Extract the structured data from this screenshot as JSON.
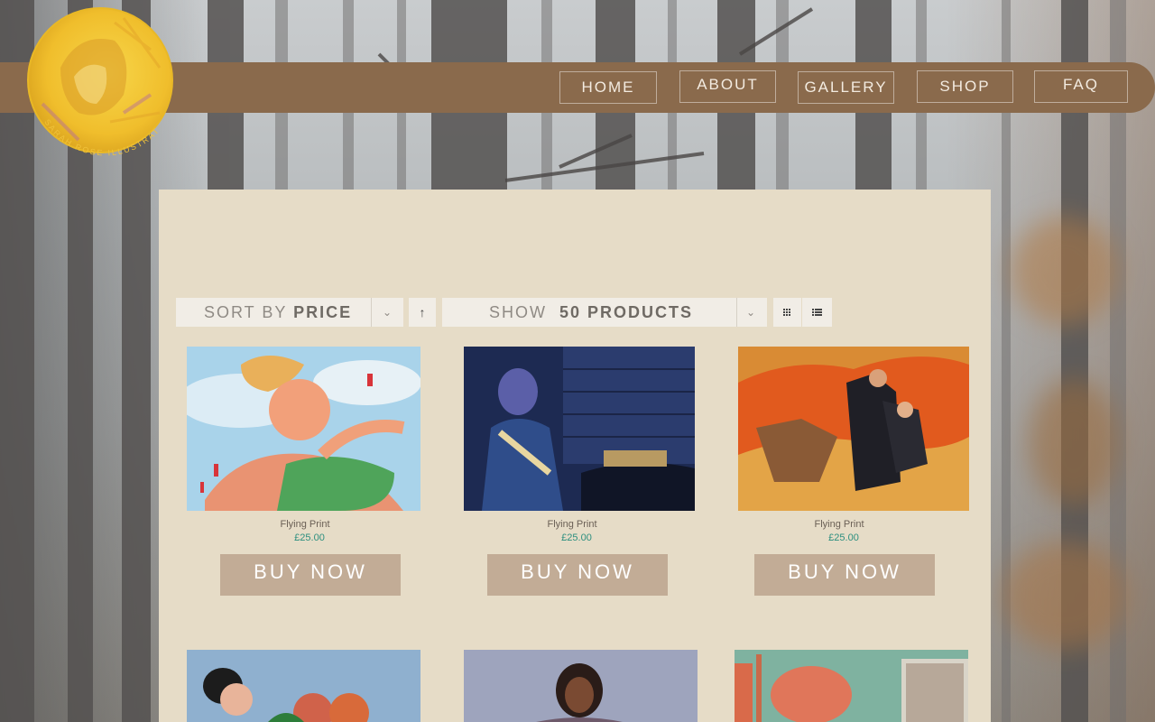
{
  "brand": {
    "logo_text": "SARAH ROSE ILLUSTRATIONS"
  },
  "nav": {
    "items": [
      {
        "label": "HOME"
      },
      {
        "label": "ABOUT"
      },
      {
        "label": "GALLERY"
      },
      {
        "label": "SHOP"
      },
      {
        "label": "FAQ"
      }
    ]
  },
  "shop": {
    "sort": {
      "prefix": "SORT BY",
      "value": "PRICE"
    },
    "show": {
      "prefix": "SHOW",
      "value": "50 PRODUCTS"
    },
    "products": [
      {
        "title": "Flying Print",
        "price": "£25.00",
        "button": "BUY NOW"
      },
      {
        "title": "Flying Print",
        "price": "£25.00",
        "button": "BUY NOW"
      },
      {
        "title": "Flying Print",
        "price": "£25.00",
        "button": "BUY NOW"
      }
    ]
  },
  "colors": {
    "nav_bg": "#8a6a4c",
    "panel_bg": "#e6dcc7",
    "button_bg": "#c2ac96",
    "price": "#2d8f7f",
    "logo_gold": "#f2c230"
  },
  "icons": {
    "sort_direction": "arrow-up-icon",
    "grid_view": "grid-icon",
    "list_view": "list-icon",
    "dropdown": "chevron-down-icon"
  }
}
